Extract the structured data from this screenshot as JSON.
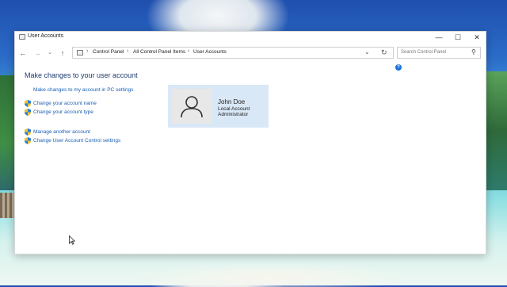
{
  "window": {
    "title": "User Accounts",
    "controls": {
      "minimize": "—",
      "maximize": "☐",
      "close": "✕"
    }
  },
  "toolbar": {
    "back": "←",
    "forward": "→",
    "recent": "⌄",
    "up": "↑",
    "address_drop": "⌄",
    "refresh": "↻"
  },
  "breadcrumb": [
    "Control Panel",
    "All Control Panel Items",
    "User Accounts"
  ],
  "search": {
    "placeholder": "Search Control Panel",
    "icon": "search-icon"
  },
  "main": {
    "heading": "Make changes to your user account",
    "pc_settings_link": "Make changes to my account in PC settings",
    "tasks": [
      "Change your account name",
      "Change your account type",
      "Manage another account",
      "Change User Account Control settings"
    ]
  },
  "user": {
    "name": "John Doe",
    "account_type": "Local Account",
    "role": "Administrator"
  },
  "colors": {
    "link": "#1a5fb4",
    "heading": "#1e3a6e",
    "user_card": "#d9e8f6",
    "help_badge": "#1a73d9"
  }
}
